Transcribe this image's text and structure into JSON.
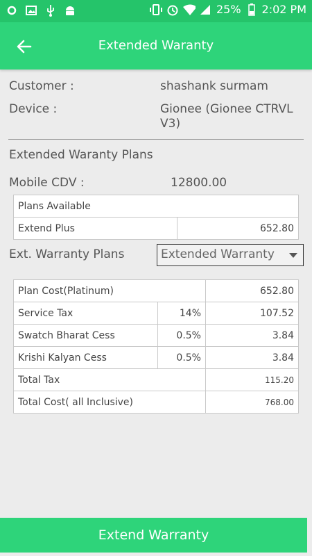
{
  "status_bar": {
    "left_icons": [
      "circle-icon",
      "image-icon",
      "usb-icon",
      "android-icon"
    ],
    "right_icons": [
      "vibrate-icon",
      "alarm-icon",
      "wifi-icon",
      "signal-icon"
    ],
    "battery": "25%",
    "time": "2:02 PM"
  },
  "app_bar": {
    "title": "Extended Waranty"
  },
  "customer": {
    "label": "Customer :",
    "value": "shashank surmam"
  },
  "device": {
    "label": "Device :",
    "value_line1": "Gionee (Gionee CTRVL",
    "value_line2": "V3)"
  },
  "plans_heading": "Extended Waranty Plans",
  "mobile_cdv": {
    "label": "Mobile CDV :",
    "value": "12800.00"
  },
  "plans_table": {
    "header": "Plans Available",
    "plan_name": "Extend Plus",
    "plan_value": "652.80"
  },
  "ext_plans": {
    "label": "Ext. Warranty Plans",
    "selected": "Extended Warranty"
  },
  "cost_table": {
    "plan_cost": {
      "label": "Plan Cost(Platinum)",
      "value": "652.80"
    },
    "service_tax": {
      "label": "Service Tax",
      "pct": "14%",
      "value": "107.52"
    },
    "swatch": {
      "label": "Swatch Bharat Cess",
      "pct": "0.5%",
      "value": "3.84"
    },
    "krishi": {
      "label": "Krishi Kalyan Cess",
      "pct": "0.5%",
      "value": "3.84"
    },
    "total_tax": {
      "label": "Total Tax",
      "value": "115.20"
    },
    "total_cost": {
      "label": "Total Cost( all Inclusive)",
      "value": "768.00"
    }
  },
  "bottom_button": "Extend Warranty",
  "colors": {
    "primary": "#2ed47a",
    "status_bar": "#25c46a",
    "background": "#ececec"
  }
}
